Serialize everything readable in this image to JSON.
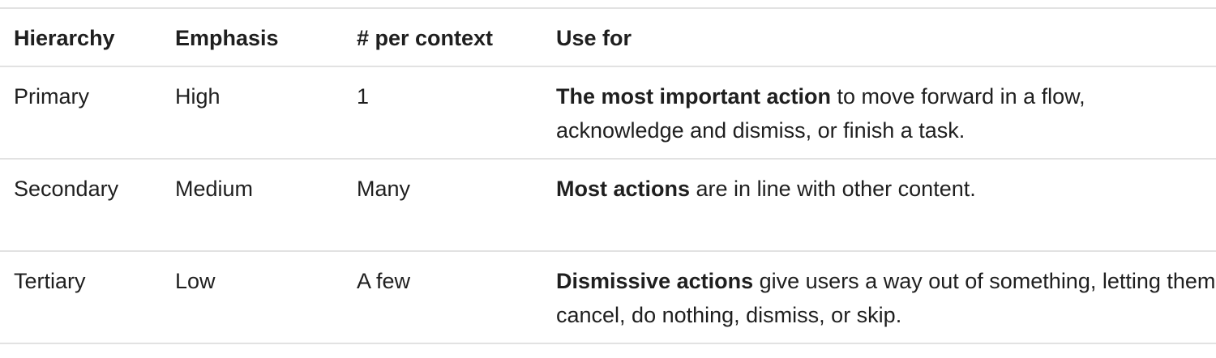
{
  "table": {
    "headers": [
      "Hierarchy",
      "Emphasis",
      "# per context",
      "Use for"
    ],
    "rows": [
      {
        "hierarchy": "Primary",
        "emphasis": "High",
        "per_context": "1",
        "use_for_bold": "The most important action",
        "use_for_rest": " to move forward in a flow, acknowledge and dismiss, or finish a task."
      },
      {
        "hierarchy": "Secondary",
        "emphasis": "Medium",
        "per_context": "Many",
        "use_for_bold": "Most actions",
        "use_for_rest": " are in line with other content."
      },
      {
        "hierarchy": "Tertiary",
        "emphasis": "Low",
        "per_context": "A few",
        "use_for_bold": "Dismissive actions",
        "use_for_rest": " give users a way out of something, letting them cancel, do nothing, dismiss, or skip."
      }
    ]
  }
}
